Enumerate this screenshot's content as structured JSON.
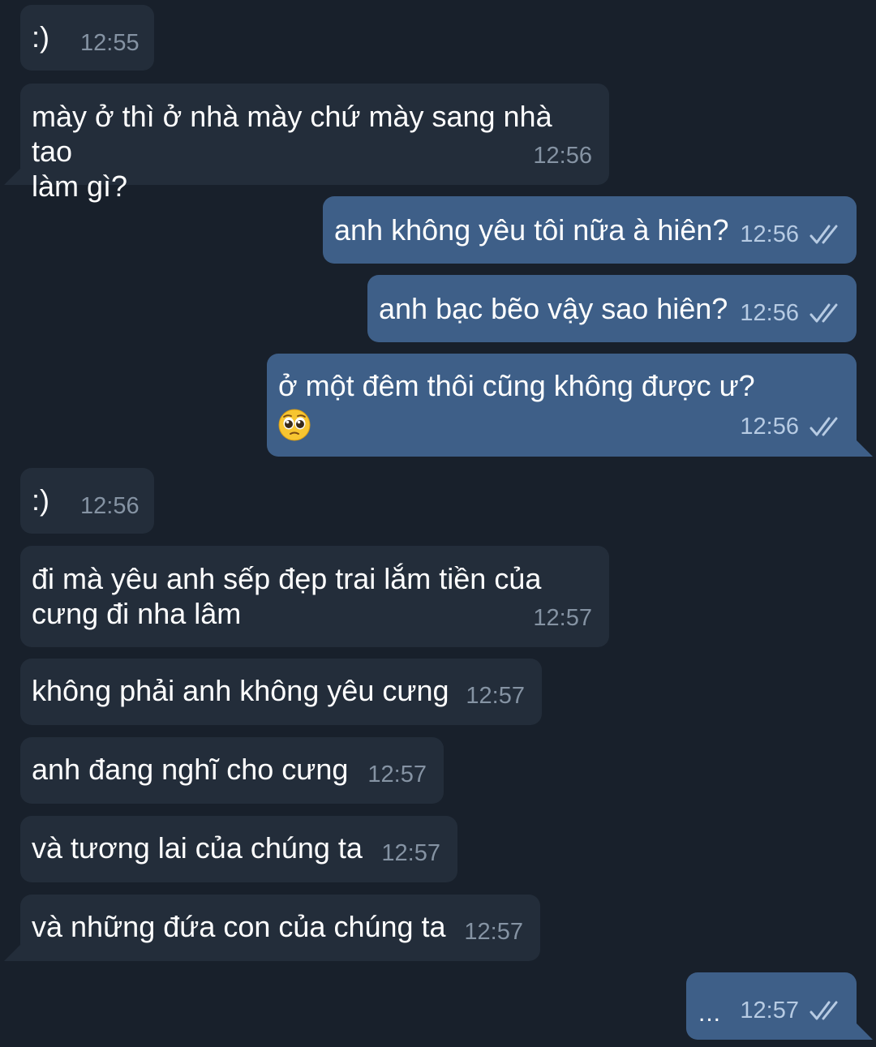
{
  "colors": {
    "background": "#18202b",
    "incoming_bubble": "#232d3a",
    "outgoing_bubble": "#3e5f88",
    "outgoing_meta": "#b7cbe3",
    "incoming_meta": "#8593a3"
  },
  "messages": [
    {
      "direction": "in",
      "text": ":)",
      "time": "12:55"
    },
    {
      "direction": "in",
      "text": "mày ở thì ở nhà mày chứ mày sang nhà tao\nlàm gì?",
      "time": "12:56"
    },
    {
      "direction": "out",
      "text": "anh không yêu tôi nữa à hiên?",
      "time": "12:56",
      "status": "read"
    },
    {
      "direction": "out",
      "text": "anh bạc bẽo vậy sao hiên?",
      "time": "12:56",
      "status": "read"
    },
    {
      "direction": "out",
      "text": "ở một đêm thôi cũng không được ư?",
      "emoji": "pleading-face-emoji",
      "time": "12:56",
      "status": "read"
    },
    {
      "direction": "in",
      "text": ":)",
      "time": "12:56"
    },
    {
      "direction": "in",
      "text": "đi mà yêu anh sếp đẹp trai lắm tiền của\ncưng đi nha lâm",
      "time": "12:57"
    },
    {
      "direction": "in",
      "text": "không phải anh không yêu cưng",
      "time": "12:57"
    },
    {
      "direction": "in",
      "text": "anh đang nghĩ cho cưng",
      "time": "12:57"
    },
    {
      "direction": "in",
      "text": "và tương lai của chúng ta",
      "time": "12:57"
    },
    {
      "direction": "in",
      "text": "và những đứa con của chúng ta",
      "time": "12:57"
    },
    {
      "direction": "out",
      "text": "...",
      "time": "12:57",
      "status": "read"
    }
  ]
}
